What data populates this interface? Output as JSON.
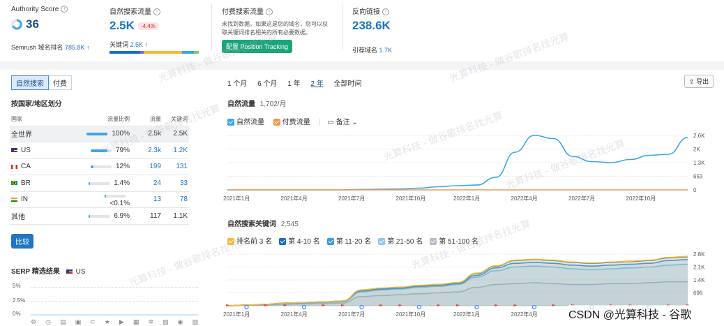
{
  "metrics": {
    "authority": {
      "title": "Authority Score",
      "value": "36",
      "rank_label": "Semrush 域名排名",
      "rank_value": "785.8K ↑"
    },
    "organic": {
      "title": "自然搜索流量",
      "value": "2.5K",
      "delta": "-4.4%",
      "kw_label": "关键词",
      "kw_value": "2.5K ↑"
    },
    "paid": {
      "title": "付费搜索流量",
      "desc_line1": "未找到数据。如果这是您的域名，您可以获",
      "desc_line2": "取关键词排名相关的所有必要数据。",
      "button": "配置 Position Tracking"
    },
    "backlinks": {
      "title": "反向链接",
      "value": "238.6K",
      "ref_label": "引荐域名",
      "ref_value": "1.7K"
    }
  },
  "tabs": {
    "organic": "自然搜索",
    "paid": "付费"
  },
  "country_section": {
    "title": "按国家/地区划分",
    "columns": [
      "国家",
      "流量比例",
      "流量",
      "关键词"
    ],
    "rows": [
      {
        "name": "全世界",
        "share": "100%",
        "pct": 100,
        "traffic": "2.5k",
        "keywords": "2.5K"
      },
      {
        "name": "US",
        "share": "79%",
        "pct": 79,
        "traffic": "2.3k",
        "keywords": "1.2K"
      },
      {
        "name": "CA",
        "share": "12%",
        "pct": 12,
        "traffic": "199",
        "keywords": "131"
      },
      {
        "name": "BR",
        "share": "1.4%",
        "pct": 1.4,
        "traffic": "24",
        "keywords": "33"
      },
      {
        "name": "IN",
        "share": "<0.1%",
        "pct": 0.1,
        "traffic": "13",
        "keywords": "78"
      },
      {
        "name": "其他",
        "share": "6.9%",
        "pct": 6.9,
        "traffic": "117",
        "keywords": "1.1K"
      }
    ],
    "compare_button": "比较"
  },
  "serp": {
    "title": "SERP 精选结果",
    "country": "US",
    "yticks": [
      "5%",
      "2.5%",
      "0%"
    ]
  },
  "time_range": {
    "items": [
      "1 个月",
      "6 个月",
      "1 年",
      "2 年",
      "全部时间"
    ],
    "active": 3
  },
  "export_button": "导出",
  "traffic_chart": {
    "title": "自然流量",
    "count": "1,702/月",
    "legend": {
      "organic": "自然流量",
      "paid": "付费流量",
      "notes": "备注"
    },
    "colors": {
      "organic": "#3aa6e8",
      "paid": "#f29b4b"
    }
  },
  "keywords_chart": {
    "title": "自然搜索关键词",
    "count": "2,545",
    "legend": [
      "排名前 3 名",
      "第 4-10 名",
      "第 11-20 名",
      "第 21-50 名",
      "第 51-100 名"
    ],
    "colors": [
      "#f5b93b",
      "#1a6fc4",
      "#3a9be0",
      "#8ccaf2",
      "#b8bcc8"
    ]
  },
  "chart_data": [
    {
      "type": "area",
      "title": "自然流量",
      "x": [
        "2021年1月",
        "2021年2月",
        "2021年3月",
        "2021年4月",
        "2021年5月",
        "2021年6月",
        "2021年7月",
        "2021年8月",
        "2021年9月",
        "2021年10月",
        "2021年11月",
        "2021年12月",
        "2022年1月",
        "2022年2月",
        "2022年3月",
        "2022年4月",
        "2022年5月",
        "2022年6月",
        "2022年7月",
        "2022年8月",
        "2022年9月",
        "2022年10月",
        "2022年11月",
        "2022年12月",
        "2023年1月"
      ],
      "xticks": [
        "2021年1月",
        "2021年4月",
        "2021年7月",
        "2021年10月",
        "2022年1月",
        "2022年4月",
        "2022年7月",
        "2022年10月"
      ],
      "yticks": [
        "2.6K",
        "2K",
        "1.3K",
        "653",
        "0"
      ],
      "ylim": [
        0,
        2600
      ],
      "series": [
        {
          "name": "自然流量",
          "values": [
            0,
            0,
            0,
            0,
            0,
            0,
            0,
            20,
            30,
            40,
            80,
            150,
            200,
            230,
            600,
            1800,
            2600,
            2450,
            1600,
            1350,
            1300,
            1450,
            1650,
            1700,
            2500
          ]
        },
        {
          "name": "付费流量",
          "values": [
            0,
            0,
            0,
            0,
            0,
            0,
            0,
            0,
            0,
            0,
            0,
            0,
            0,
            0,
            0,
            0,
            0,
            0,
            0,
            0,
            0,
            0,
            0,
            0,
            0
          ]
        }
      ]
    },
    {
      "type": "area",
      "title": "自然搜索关键词",
      "x": [
        "2021年1月",
        "2021年2月",
        "2021年3月",
        "2021年4月",
        "2021年5月",
        "2021年6月",
        "2021年7月",
        "2021年8月",
        "2021年9月",
        "2021年10月",
        "2021年11月",
        "2021年12月",
        "2022年1月",
        "2022年2月",
        "2022年3月",
        "2022年4月",
        "2022年5月",
        "2022年6月",
        "2022年7月",
        "2022年8月",
        "2022年9月",
        "2022年10月",
        "2022年11月",
        "2022年12月",
        "2023年1月"
      ],
      "xticks": [
        "2021年1月",
        "2021年4月",
        "2021年7月",
        "2021年10月",
        "2022年1月",
        "2022年4月",
        "2022年7月",
        "2022年10月"
      ],
      "yticks": [
        "2.8K",
        "2.1K",
        "1.4K",
        "696"
      ],
      "ylim": [
        0,
        2800
      ],
      "series": [
        {
          "name": "第 51-100 名",
          "values": [
            0,
            20,
            40,
            80,
            100,
            120,
            150,
            500,
            550,
            600,
            650,
            700,
            750,
            1000,
            1150,
            1200,
            1250,
            1200,
            1150,
            1150,
            1200,
            1200,
            1250,
            1300,
            1300
          ]
        },
        {
          "name": "第 21-50 名",
          "values": [
            0,
            30,
            60,
            120,
            150,
            180,
            220,
            750,
            850,
            900,
            1000,
            1050,
            1150,
            1550,
            1900,
            2100,
            2150,
            2100,
            2000,
            1950,
            2000,
            2050,
            2100,
            2200,
            2250
          ]
        },
        {
          "name": "第 11-20 名",
          "values": [
            0,
            35,
            70,
            140,
            170,
            200,
            250,
            800,
            900,
            950,
            1050,
            1100,
            1200,
            1650,
            2050,
            2300,
            2350,
            2300,
            2200,
            2150,
            2200,
            2250,
            2300,
            2450,
            2500
          ]
        },
        {
          "name": "第 4-10 名",
          "values": [
            0,
            40,
            80,
            150,
            180,
            210,
            260,
            850,
            950,
            1000,
            1100,
            1150,
            1250,
            1750,
            2150,
            2450,
            2500,
            2450,
            2350,
            2300,
            2350,
            2400,
            2450,
            2600,
            2650
          ]
        },
        {
          "name": "排名前 3 名",
          "values": [
            0,
            40,
            80,
            150,
            180,
            210,
            260,
            860,
            960,
            1010,
            1110,
            1160,
            1260,
            1770,
            2170,
            2470,
            2520,
            2470,
            2370,
            2320,
            2370,
            2420,
            2470,
            2620,
            2680
          ]
        }
      ]
    }
  ],
  "watermarks": [
    "光算科技 - 做谷歌排名找光算"
  ],
  "footer_watermark": "CSDN @光算科技 - 谷歌"
}
